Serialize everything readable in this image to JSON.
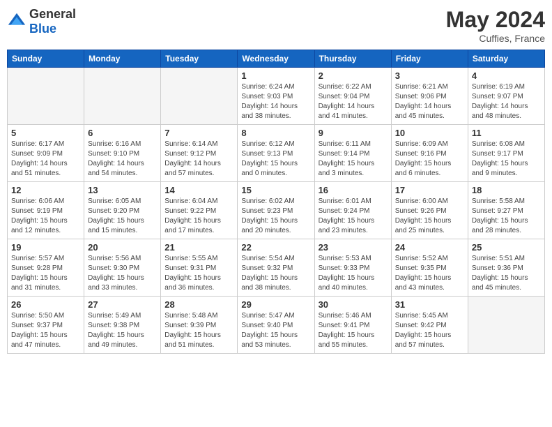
{
  "header": {
    "logo_general": "General",
    "logo_blue": "Blue",
    "month_year": "May 2024",
    "location": "Cuffies, France"
  },
  "weekdays": [
    "Sunday",
    "Monday",
    "Tuesday",
    "Wednesday",
    "Thursday",
    "Friday",
    "Saturday"
  ],
  "weeks": [
    [
      {
        "day": "",
        "info": "",
        "empty": true
      },
      {
        "day": "",
        "info": "",
        "empty": true
      },
      {
        "day": "",
        "info": "",
        "empty": true
      },
      {
        "day": "1",
        "info": "Sunrise: 6:24 AM\nSunset: 9:03 PM\nDaylight: 14 hours\nand 38 minutes.",
        "empty": false
      },
      {
        "day": "2",
        "info": "Sunrise: 6:22 AM\nSunset: 9:04 PM\nDaylight: 14 hours\nand 41 minutes.",
        "empty": false
      },
      {
        "day": "3",
        "info": "Sunrise: 6:21 AM\nSunset: 9:06 PM\nDaylight: 14 hours\nand 45 minutes.",
        "empty": false
      },
      {
        "day": "4",
        "info": "Sunrise: 6:19 AM\nSunset: 9:07 PM\nDaylight: 14 hours\nand 48 minutes.",
        "empty": false
      }
    ],
    [
      {
        "day": "5",
        "info": "Sunrise: 6:17 AM\nSunset: 9:09 PM\nDaylight: 14 hours\nand 51 minutes.",
        "empty": false
      },
      {
        "day": "6",
        "info": "Sunrise: 6:16 AM\nSunset: 9:10 PM\nDaylight: 14 hours\nand 54 minutes.",
        "empty": false
      },
      {
        "day": "7",
        "info": "Sunrise: 6:14 AM\nSunset: 9:12 PM\nDaylight: 14 hours\nand 57 minutes.",
        "empty": false
      },
      {
        "day": "8",
        "info": "Sunrise: 6:12 AM\nSunset: 9:13 PM\nDaylight: 15 hours\nand 0 minutes.",
        "empty": false
      },
      {
        "day": "9",
        "info": "Sunrise: 6:11 AM\nSunset: 9:14 PM\nDaylight: 15 hours\nand 3 minutes.",
        "empty": false
      },
      {
        "day": "10",
        "info": "Sunrise: 6:09 AM\nSunset: 9:16 PM\nDaylight: 15 hours\nand 6 minutes.",
        "empty": false
      },
      {
        "day": "11",
        "info": "Sunrise: 6:08 AM\nSunset: 9:17 PM\nDaylight: 15 hours\nand 9 minutes.",
        "empty": false
      }
    ],
    [
      {
        "day": "12",
        "info": "Sunrise: 6:06 AM\nSunset: 9:19 PM\nDaylight: 15 hours\nand 12 minutes.",
        "empty": false
      },
      {
        "day": "13",
        "info": "Sunrise: 6:05 AM\nSunset: 9:20 PM\nDaylight: 15 hours\nand 15 minutes.",
        "empty": false
      },
      {
        "day": "14",
        "info": "Sunrise: 6:04 AM\nSunset: 9:22 PM\nDaylight: 15 hours\nand 17 minutes.",
        "empty": false
      },
      {
        "day": "15",
        "info": "Sunrise: 6:02 AM\nSunset: 9:23 PM\nDaylight: 15 hours\nand 20 minutes.",
        "empty": false
      },
      {
        "day": "16",
        "info": "Sunrise: 6:01 AM\nSunset: 9:24 PM\nDaylight: 15 hours\nand 23 minutes.",
        "empty": false
      },
      {
        "day": "17",
        "info": "Sunrise: 6:00 AM\nSunset: 9:26 PM\nDaylight: 15 hours\nand 25 minutes.",
        "empty": false
      },
      {
        "day": "18",
        "info": "Sunrise: 5:58 AM\nSunset: 9:27 PM\nDaylight: 15 hours\nand 28 minutes.",
        "empty": false
      }
    ],
    [
      {
        "day": "19",
        "info": "Sunrise: 5:57 AM\nSunset: 9:28 PM\nDaylight: 15 hours\nand 31 minutes.",
        "empty": false
      },
      {
        "day": "20",
        "info": "Sunrise: 5:56 AM\nSunset: 9:30 PM\nDaylight: 15 hours\nand 33 minutes.",
        "empty": false
      },
      {
        "day": "21",
        "info": "Sunrise: 5:55 AM\nSunset: 9:31 PM\nDaylight: 15 hours\nand 36 minutes.",
        "empty": false
      },
      {
        "day": "22",
        "info": "Sunrise: 5:54 AM\nSunset: 9:32 PM\nDaylight: 15 hours\nand 38 minutes.",
        "empty": false
      },
      {
        "day": "23",
        "info": "Sunrise: 5:53 AM\nSunset: 9:33 PM\nDaylight: 15 hours\nand 40 minutes.",
        "empty": false
      },
      {
        "day": "24",
        "info": "Sunrise: 5:52 AM\nSunset: 9:35 PM\nDaylight: 15 hours\nand 43 minutes.",
        "empty": false
      },
      {
        "day": "25",
        "info": "Sunrise: 5:51 AM\nSunset: 9:36 PM\nDaylight: 15 hours\nand 45 minutes.",
        "empty": false
      }
    ],
    [
      {
        "day": "26",
        "info": "Sunrise: 5:50 AM\nSunset: 9:37 PM\nDaylight: 15 hours\nand 47 minutes.",
        "empty": false
      },
      {
        "day": "27",
        "info": "Sunrise: 5:49 AM\nSunset: 9:38 PM\nDaylight: 15 hours\nand 49 minutes.",
        "empty": false
      },
      {
        "day": "28",
        "info": "Sunrise: 5:48 AM\nSunset: 9:39 PM\nDaylight: 15 hours\nand 51 minutes.",
        "empty": false
      },
      {
        "day": "29",
        "info": "Sunrise: 5:47 AM\nSunset: 9:40 PM\nDaylight: 15 hours\nand 53 minutes.",
        "empty": false
      },
      {
        "day": "30",
        "info": "Sunrise: 5:46 AM\nSunset: 9:41 PM\nDaylight: 15 hours\nand 55 minutes.",
        "empty": false
      },
      {
        "day": "31",
        "info": "Sunrise: 5:45 AM\nSunset: 9:42 PM\nDaylight: 15 hours\nand 57 minutes.",
        "empty": false
      },
      {
        "day": "",
        "info": "",
        "empty": true
      }
    ]
  ]
}
